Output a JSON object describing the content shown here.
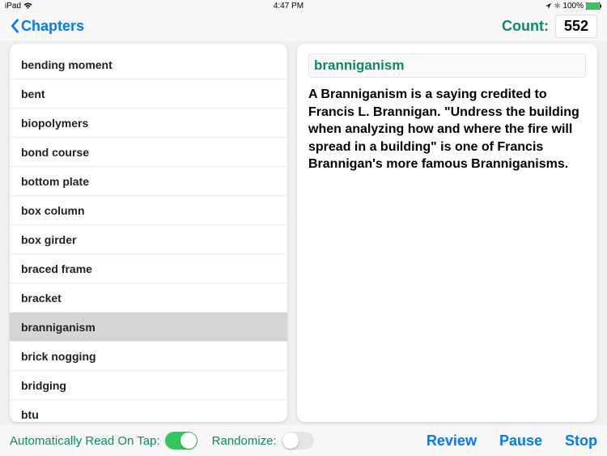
{
  "status": {
    "device": "iPad",
    "time": "4:47 PM",
    "battery": "100%"
  },
  "nav": {
    "back_label": "Chapters",
    "count_label": "Count:",
    "count_value": "552"
  },
  "terms": [
    "bending moment",
    "bent",
    "biopolymers",
    "bond course",
    "bottom plate",
    "box column",
    "box girder",
    "braced frame",
    "bracket",
    "branniganism",
    "brick nogging",
    "bridging",
    "btu"
  ],
  "selected_index": 9,
  "detail": {
    "title": "branniganism",
    "definition": "A Branniganism is a saying credited to Francis L. Brannigan.  \"Undress the building when analyzing how and where the fire will spread in a building\" is one of Francis Brannigan's more famous Branniganisms."
  },
  "bottom": {
    "auto_read_label": "Automatically Read On Tap:",
    "auto_read_on": true,
    "randomize_label": "Randomize:",
    "randomize_on": false,
    "review": "Review",
    "pause": "Pause",
    "stop": "Stop"
  }
}
